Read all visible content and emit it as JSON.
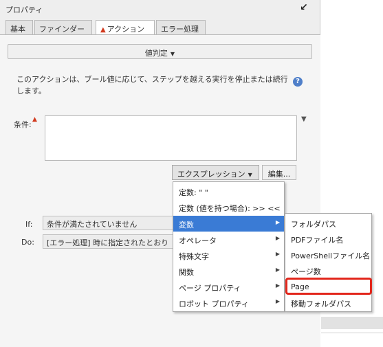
{
  "panel": {
    "title": "プロパティ",
    "tabs": [
      {
        "label": "基本",
        "active": false
      },
      {
        "label": "ファインダー",
        "active": false
      },
      {
        "label": "アクション",
        "active": true,
        "warning": true
      },
      {
        "label": "エラー処理",
        "active": false
      }
    ]
  },
  "action": {
    "value_check_label": "値判定",
    "description": "このアクションは、ブール値に応じて、ステップを越える実行を停止または続行します。",
    "condition_label": "条件:",
    "condition_value": "",
    "expression_button": "エクスプレッション",
    "edit_button": "編集...",
    "if_label": "If:",
    "if_value": "条件が満たされていません",
    "do_label": "Do:",
    "do_value": "[エラー処理] 時に指定されたとおり"
  },
  "menu": {
    "items": [
      {
        "label": "定数: \" \"",
        "submenu": false
      },
      {
        "label": "定数 (値を持つ場合): >> <<",
        "submenu": false
      },
      {
        "label": "変数",
        "submenu": true,
        "selected": true
      },
      {
        "label": "オペレータ",
        "submenu": true
      },
      {
        "label": "特殊文字",
        "submenu": true
      },
      {
        "label": "関数",
        "submenu": true
      },
      {
        "label": "ページ プロパティ",
        "submenu": true
      },
      {
        "label": "ロボット プロパティ",
        "submenu": true
      }
    ],
    "submenu_items": [
      {
        "label": "フォルダパス"
      },
      {
        "label": "PDFファイル名"
      },
      {
        "label": "PowerShellファイル名"
      },
      {
        "label": "ページ数"
      },
      {
        "label": "Page",
        "highlighted": true
      },
      {
        "label": "移動フォルダパス"
      }
    ]
  },
  "colors": {
    "selected": "#3a7bd5",
    "highlight_border": "#e2261b",
    "warning": "#d13a1e"
  }
}
